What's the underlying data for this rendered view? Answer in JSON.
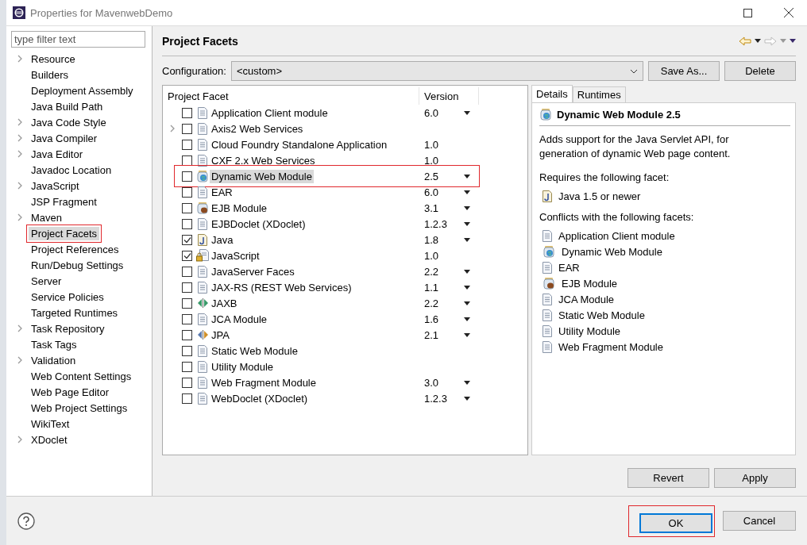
{
  "window": {
    "title": "Properties for MavenwebDemo"
  },
  "sidebar": {
    "filter": {
      "placeholder": "type filter text"
    },
    "items": [
      {
        "label": "Resource",
        "expandable": true,
        "selected": false,
        "annotated": false
      },
      {
        "label": "Builders",
        "expandable": false,
        "selected": false,
        "annotated": false
      },
      {
        "label": "Deployment Assembly",
        "expandable": false,
        "selected": false,
        "annotated": false
      },
      {
        "label": "Java Build Path",
        "expandable": false,
        "selected": false,
        "annotated": false
      },
      {
        "label": "Java Code Style",
        "expandable": true,
        "selected": false,
        "annotated": false
      },
      {
        "label": "Java Compiler",
        "expandable": true,
        "selected": false,
        "annotated": false
      },
      {
        "label": "Java Editor",
        "expandable": true,
        "selected": false,
        "annotated": false
      },
      {
        "label": "Javadoc Location",
        "expandable": false,
        "selected": false,
        "annotated": false
      },
      {
        "label": "JavaScript",
        "expandable": true,
        "selected": false,
        "annotated": false
      },
      {
        "label": "JSP Fragment",
        "expandable": false,
        "selected": false,
        "annotated": false
      },
      {
        "label": "Maven",
        "expandable": true,
        "selected": false,
        "annotated": false
      },
      {
        "label": "Project Facets",
        "expandable": false,
        "selected": true,
        "annotated": true
      },
      {
        "label": "Project References",
        "expandable": false,
        "selected": false,
        "annotated": false
      },
      {
        "label": "Run/Debug Settings",
        "expandable": false,
        "selected": false,
        "annotated": false
      },
      {
        "label": "Server",
        "expandable": false,
        "selected": false,
        "annotated": false
      },
      {
        "label": "Service Policies",
        "expandable": false,
        "selected": false,
        "annotated": false
      },
      {
        "label": "Targeted Runtimes",
        "expandable": false,
        "selected": false,
        "annotated": false
      },
      {
        "label": "Task Repository",
        "expandable": true,
        "selected": false,
        "annotated": false
      },
      {
        "label": "Task Tags",
        "expandable": false,
        "selected": false,
        "annotated": false
      },
      {
        "label": "Validation",
        "expandable": true,
        "selected": false,
        "annotated": false
      },
      {
        "label": "Web Content Settings",
        "expandable": false,
        "selected": false,
        "annotated": false
      },
      {
        "label": "Web Page Editor",
        "expandable": false,
        "selected": false,
        "annotated": false
      },
      {
        "label": "Web Project Settings",
        "expandable": false,
        "selected": false,
        "annotated": false
      },
      {
        "label": "WikiText",
        "expandable": false,
        "selected": false,
        "annotated": false
      },
      {
        "label": "XDoclet",
        "expandable": true,
        "selected": false,
        "annotated": false
      }
    ]
  },
  "page": {
    "title": "Project Facets"
  },
  "configuration": {
    "label": "Configuration:",
    "value": "<custom>",
    "buttons": [
      "Save As...",
      "Delete"
    ]
  },
  "facets": {
    "columns": [
      "Project Facet",
      "Version"
    ],
    "rows": [
      {
        "name": "Application Client module",
        "kind": "doc",
        "checked": false,
        "version": "6.0",
        "dropdown": true,
        "expandable": false,
        "selected": false,
        "annotated": false
      },
      {
        "name": "Axis2 Web Services",
        "kind": "doc",
        "checked": false,
        "version": "",
        "dropdown": false,
        "expandable": true,
        "selected": false,
        "annotated": false
      },
      {
        "name": "Cloud Foundry Standalone Application",
        "kind": "doc",
        "checked": false,
        "version": "1.0",
        "dropdown": false,
        "expandable": false,
        "selected": false,
        "annotated": false
      },
      {
        "name": "CXF 2.x Web Services",
        "kind": "doc",
        "checked": false,
        "version": "1.0",
        "dropdown": false,
        "expandable": false,
        "selected": false,
        "annotated": false
      },
      {
        "name": "Dynamic Web Module",
        "kind": "web",
        "checked": false,
        "version": "2.5",
        "dropdown": true,
        "expandable": false,
        "selected": true,
        "annotated": true
      },
      {
        "name": "EAR",
        "kind": "doc",
        "checked": false,
        "version": "6.0",
        "dropdown": true,
        "expandable": false,
        "selected": false,
        "annotated": false
      },
      {
        "name": "EJB Module",
        "kind": "ejb",
        "checked": false,
        "version": "3.1",
        "dropdown": true,
        "expandable": false,
        "selected": false,
        "annotated": false
      },
      {
        "name": "EJBDoclet (XDoclet)",
        "kind": "doc",
        "checked": false,
        "version": "1.2.3",
        "dropdown": true,
        "expandable": false,
        "selected": false,
        "annotated": false
      },
      {
        "name": "Java",
        "kind": "java",
        "checked": true,
        "version": "1.8",
        "dropdown": true,
        "expandable": false,
        "selected": false,
        "annotated": false
      },
      {
        "name": "JavaScript",
        "kind": "lock",
        "checked": true,
        "version": "1.0",
        "dropdown": false,
        "expandable": false,
        "selected": false,
        "annotated": false
      },
      {
        "name": "JavaServer Faces",
        "kind": "doc",
        "checked": false,
        "version": "2.2",
        "dropdown": true,
        "expandable": false,
        "selected": false,
        "annotated": false
      },
      {
        "name": "JAX-RS (REST Web Services)",
        "kind": "doc",
        "checked": false,
        "version": "1.1",
        "dropdown": true,
        "expandable": false,
        "selected": false,
        "annotated": false
      },
      {
        "name": "JAXB",
        "kind": "xml",
        "checked": false,
        "version": "2.2",
        "dropdown": true,
        "expandable": false,
        "selected": false,
        "annotated": false
      },
      {
        "name": "JCA Module",
        "kind": "doc",
        "checked": false,
        "version": "1.6",
        "dropdown": true,
        "expandable": false,
        "selected": false,
        "annotated": false
      },
      {
        "name": "JPA",
        "kind": "jpa",
        "checked": false,
        "version": "2.1",
        "dropdown": true,
        "expandable": false,
        "selected": false,
        "annotated": false
      },
      {
        "name": "Static Web Module",
        "kind": "doc",
        "checked": false,
        "version": "",
        "dropdown": false,
        "expandable": false,
        "selected": false,
        "annotated": false
      },
      {
        "name": "Utility Module",
        "kind": "doc",
        "checked": false,
        "version": "",
        "dropdown": false,
        "expandable": false,
        "selected": false,
        "annotated": false
      },
      {
        "name": "Web Fragment Module",
        "kind": "doc",
        "checked": false,
        "version": "3.0",
        "dropdown": true,
        "expandable": false,
        "selected": false,
        "annotated": false
      },
      {
        "name": "WebDoclet (XDoclet)",
        "kind": "doc",
        "checked": false,
        "version": "1.2.3",
        "dropdown": true,
        "expandable": false,
        "selected": false,
        "annotated": false
      }
    ]
  },
  "details": {
    "tabs": [
      {
        "label": "Details",
        "selected": true
      },
      {
        "label": "Runtimes",
        "selected": false
      }
    ],
    "title": "Dynamic Web Module 2.5",
    "kind": "web",
    "description": "Adds support for the Java Servlet API, for generation of dynamic Web page content.",
    "requires_label": "Requires the following facet:",
    "requires": [
      {
        "label": "Java 1.5 or newer",
        "kind": "java"
      }
    ],
    "conflicts_label": "Conflicts with the following facets:",
    "conflicts": [
      {
        "label": "Application Client module",
        "kind": "doc"
      },
      {
        "label": "Dynamic Web Module",
        "kind": "web"
      },
      {
        "label": "EAR",
        "kind": "doc"
      },
      {
        "label": "EJB Module",
        "kind": "ejb"
      },
      {
        "label": "JCA Module",
        "kind": "doc"
      },
      {
        "label": "Static Web Module",
        "kind": "doc"
      },
      {
        "label": "Utility Module",
        "kind": "doc"
      },
      {
        "label": "Web Fragment Module",
        "kind": "doc"
      }
    ]
  },
  "page_buttons": [
    "Revert",
    "Apply"
  ],
  "dialog_buttons": [
    {
      "label": "OK",
      "default": true,
      "annotated": true
    },
    {
      "label": "Cancel",
      "default": false,
      "annotated": false
    }
  ]
}
